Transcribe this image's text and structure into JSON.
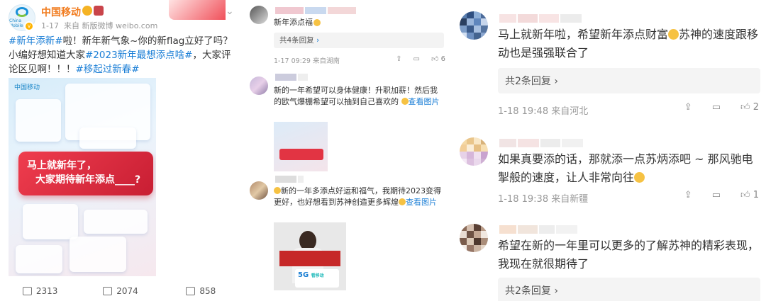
{
  "post": {
    "account": "中国移动",
    "date": "1-17",
    "source": "来自 新版微博 weibo.com",
    "text_parts": [
      "#新年添新#",
      "啦！新年新气象~你的新flag立好了吗？小编好想知道大家",
      "#2023新年最想添点啥#",
      "，大家评论区见啊！！！",
      "#移起过新春#"
    ],
    "image_logo": "中国移动",
    "image_line1": "马上就新年了，",
    "image_line2": "大家期待新年添点____?",
    "reposts": "2313",
    "comments": "2074",
    "likes": "858"
  },
  "mid_comments": [
    {
      "text": "新年添点福",
      "reply": "共4条回复",
      "meta": "1-17 09:29 来自湖南",
      "likes": "6"
    },
    {
      "text": "新的一年希望可以身体健康！升职加薪！然后我的欧气爆棚希望可以抽到自己喜欢的",
      "view": "查看图片"
    },
    {
      "text": "新的一年多添点好运和福气，我期待2023变得更好，也好想看到苏神创造更多辉煌",
      "view": "查看图片",
      "badge": "5G",
      "badge_sub": "看移动"
    }
  ],
  "right_comments": [
    {
      "text": "马上就新年啦，希望新年添点财富",
      "text2": "苏神的速度跟移动也是强强联合了",
      "reply": "共2条回复",
      "meta": "1-18 19:48 来自河北",
      "likes": "2"
    },
    {
      "text": "如果真要添的话，那就添一点苏炳添吧 ~ 那风驰电掣般的速度，让人非常向往",
      "meta": "1-18 19:38 来自新疆",
      "likes": "1"
    },
    {
      "text": "希望在新的一年里可以更多的了解苏神的精彩表现，我现在就很期待了",
      "reply": "共2条回复"
    }
  ]
}
